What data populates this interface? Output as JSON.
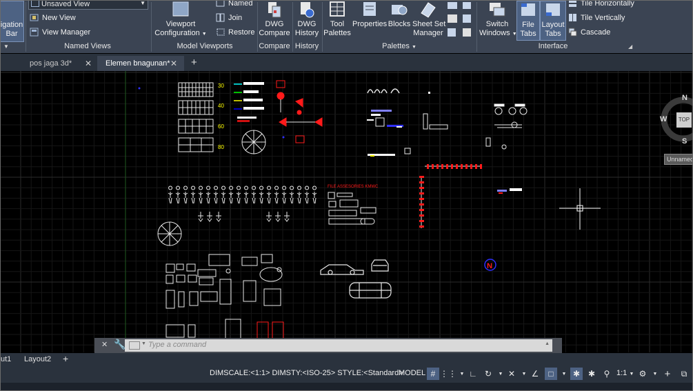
{
  "ribbon": {
    "navigation_bar": {
      "line1": "igation",
      "line2": "Bar"
    },
    "named_views": {
      "dropdown_value": "Unsaved View",
      "new_view": "New View",
      "view_manager": "View Manager",
      "title": "Named Views"
    },
    "model_viewports": {
      "viewport_config_line1": "Viewport",
      "viewport_config_line2": "Configuration",
      "named": "Named",
      "join": "Join",
      "restore": "Restore",
      "title": "Model Viewports"
    },
    "compare": {
      "line1": "DWG",
      "line2": "Compare",
      "title": "Compare"
    },
    "history": {
      "line1": "DWG",
      "line2": "History",
      "title": "History"
    },
    "palettes": {
      "tool_line1": "Tool",
      "tool_line2": "Palettes",
      "properties": "Properties",
      "blocks": "Blocks",
      "sheet_line1": "Sheet Set",
      "sheet_line2": "Manager",
      "title": "Palettes"
    },
    "interface": {
      "switch_line1": "Switch",
      "switch_line2": "Windows",
      "file_line1": "File",
      "file_line2": "Tabs",
      "layout_line1": "Layout",
      "layout_line2": "Tabs",
      "tile_h": "Tile Horizontally",
      "tile_v": "Tile Vertically",
      "cascade": "Cascade",
      "title": "Interface"
    }
  },
  "file_tabs": [
    {
      "label": "pos jaga 3d*",
      "active": false
    },
    {
      "label": "Elemen bnagunan*",
      "active": true
    }
  ],
  "viewcube": {
    "n": "N",
    "s": "S",
    "w": "W",
    "top": "TOP",
    "wcs": "Unnamed"
  },
  "drawing": {
    "table_labels": [
      "30",
      "40",
      "60",
      "80"
    ],
    "red_title": "FILE ASSESORIES KMWC",
    "north_symbol": "N"
  },
  "command_line": {
    "placeholder": "Type a command"
  },
  "layout_tabs": [
    "ut1",
    "Layout2"
  ],
  "status_bar": {
    "dim_info": "DIMSCALE:<1:1> DIMSTY:<ISO-25> STYLE:<Standard>",
    "model": "MODEL",
    "scale": "1:1"
  },
  "colors": {
    "ribbon_bg": "#3b4453",
    "tab_bg": "#2a323d",
    "canvas_bg": "#000000",
    "grid_major": "#2c2c2c",
    "grid_minor": "#161616",
    "active_blue": "#4d6283",
    "cad_red": "#ff1a1a",
    "cad_yellow": "#ffff00",
    "cad_cyan": "#00ffff"
  }
}
